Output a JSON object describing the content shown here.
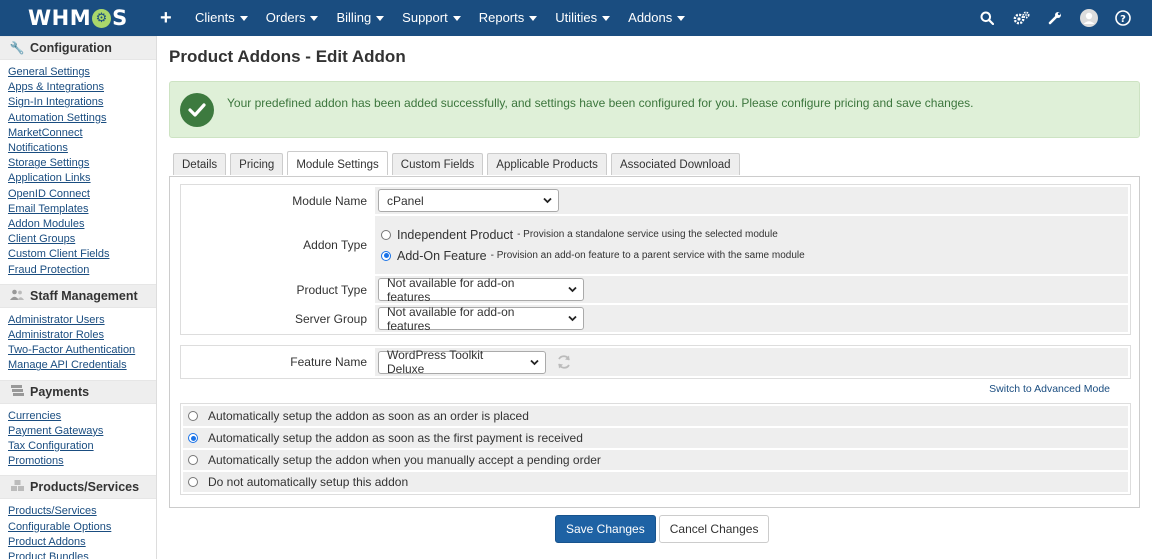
{
  "nav": {
    "logo_parts": [
      "WHM",
      "⚙",
      "S"
    ],
    "plus": "+",
    "menu": [
      "Clients",
      "Orders",
      "Billing",
      "Support",
      "Reports",
      "Utilities",
      "Addons"
    ]
  },
  "sidebar": [
    {
      "title": "Configuration",
      "links": [
        "General Settings",
        "Apps & Integrations",
        "Sign-In Integrations",
        "Automation Settings",
        "MarketConnect",
        "Notifications",
        "Storage Settings",
        "Application Links",
        "OpenID Connect",
        "Email Templates",
        "Addon Modules",
        "Client Groups",
        "Custom Client Fields",
        "Fraud Protection"
      ]
    },
    {
      "title": "Staff Management",
      "links": [
        "Administrator Users",
        "Administrator Roles",
        "Two-Factor Authentication",
        "Manage API Credentials"
      ]
    },
    {
      "title": "Payments",
      "links": [
        "Currencies",
        "Payment Gateways",
        "Tax Configuration",
        "Promotions"
      ]
    },
    {
      "title": "Products/Services",
      "links": [
        "Products/Services",
        "Configurable Options",
        "Product Addons",
        "Product Bundles"
      ]
    }
  ],
  "page": {
    "title": "Product Addons - Edit Addon",
    "alert": "Your predefined addon has been added successfully, and settings have been configured for you. Please configure pricing and save changes."
  },
  "tabs": [
    "Details",
    "Pricing",
    "Module Settings",
    "Custom Fields",
    "Applicable Products",
    "Associated Download"
  ],
  "active_tab": 2,
  "form": {
    "module_name_label": "Module Name",
    "module_name_value": "cPanel",
    "addon_type_label": "Addon Type",
    "addon_type_options": [
      {
        "label": "Independent Product",
        "desc": "- Provision a standalone service using the selected module",
        "selected": false
      },
      {
        "label": "Add-On Feature",
        "desc": "- Provision an add-on feature to a parent service with the same module",
        "selected": true
      }
    ],
    "product_type_label": "Product Type",
    "product_type_value": "Not available for add-on features",
    "server_group_label": "Server Group",
    "server_group_value": "Not available for add-on features",
    "feature_name_label": "Feature Name",
    "feature_name_value": "WordPress Toolkit Deluxe",
    "advanced_mode_link": "Switch to Advanced Mode",
    "auto_setup_options": [
      {
        "label": "Automatically setup the addon as soon as an order is placed",
        "selected": false
      },
      {
        "label": "Automatically setup the addon as soon as the first payment is received",
        "selected": true
      },
      {
        "label": "Automatically setup the addon when you manually accept a pending order",
        "selected": false
      },
      {
        "label": "Do not automatically setup this addon",
        "selected": false
      }
    ]
  },
  "buttons": {
    "save": "Save Changes",
    "cancel": "Cancel Changes"
  },
  "colors": {
    "nav_bg": "#1a4d80",
    "link": "#1a4d80",
    "primary_btn": "#1e62a4",
    "success_bg": "#dff0d8",
    "success_text": "#3c763d"
  }
}
